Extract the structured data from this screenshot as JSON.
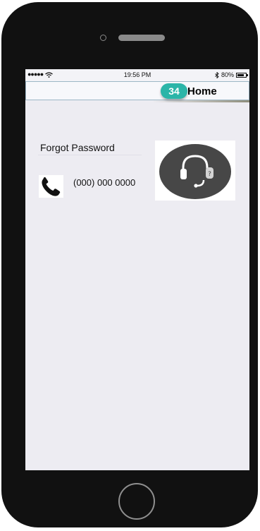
{
  "status_bar": {
    "signal_dots": "●●●●●",
    "time": "19:56 PM",
    "battery_text": "80%",
    "icons": [
      "wifi-icon",
      "bluetooth-icon",
      "battery-icon"
    ]
  },
  "nav": {
    "badge": "34",
    "title": "Home"
  },
  "content": {
    "forgot_password": "Forgot Password",
    "phone_number": "(000) 000 0000",
    "icons": [
      "phone-icon",
      "headset-support-icon"
    ]
  },
  "colors": {
    "screen_bg": "#edecf2",
    "badge_bg": "#2bb5a8",
    "support_circle": "#474747",
    "phone_body": "#111111"
  }
}
